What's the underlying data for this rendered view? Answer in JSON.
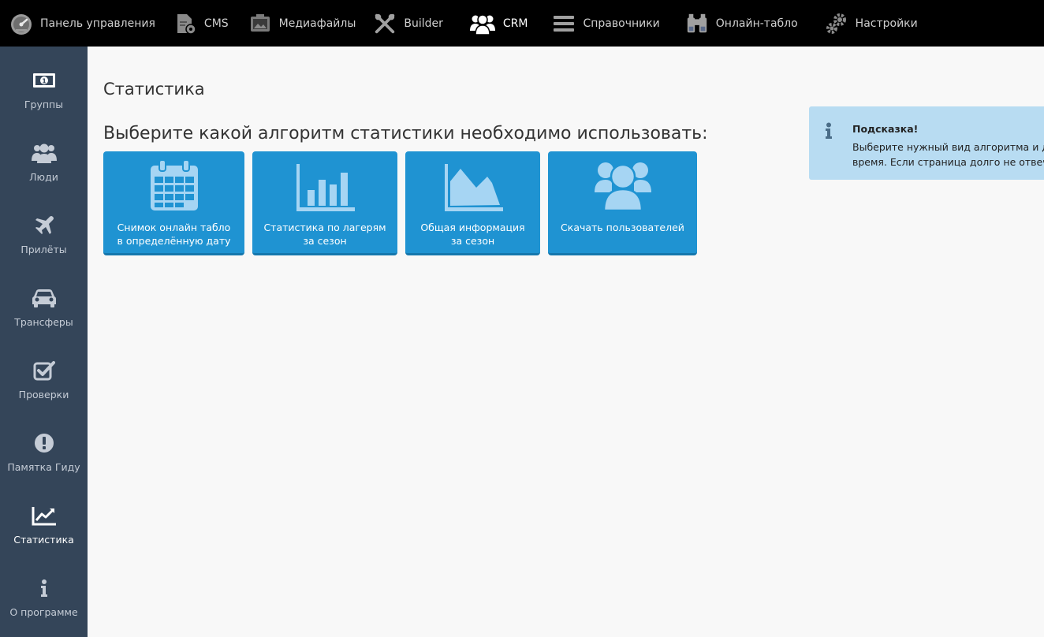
{
  "top_nav": [
    {
      "label": "Панель управления",
      "icon": "dashboard-gauge-icon"
    },
    {
      "label": "CMS",
      "icon": "cms-document-icon"
    },
    {
      "label": "Медиафайлы",
      "icon": "media-image-icon"
    },
    {
      "label": "Builder",
      "icon": "builder-tools-icon"
    },
    {
      "label": "CRM",
      "icon": "crm-users-icon",
      "active": true
    },
    {
      "label": "Справочники",
      "icon": "list-bars-icon"
    },
    {
      "label": "Онлайн-табло",
      "icon": "binoculars-icon"
    },
    {
      "label": "Настройки",
      "icon": "settings-gears-icon"
    }
  ],
  "sidebar": [
    {
      "label": "Группы",
      "icon": "money-bill-icon"
    },
    {
      "label": "Люди",
      "icon": "people-icon"
    },
    {
      "label": "Прилёты",
      "icon": "airplane-icon"
    },
    {
      "label": "Трансферы",
      "icon": "car-icon"
    },
    {
      "label": "Проверки",
      "icon": "checkbox-icon"
    },
    {
      "label": "Памятка Гиду",
      "icon": "exclamation-circle-icon"
    },
    {
      "label": "Статистика",
      "icon": "line-chart-icon",
      "active": true
    },
    {
      "label": "О программе",
      "icon": "info-icon"
    }
  ],
  "main": {
    "title": "Статистика",
    "subtitle": "Выберите какой алгоритм статистики необходимо использовать:",
    "tiles": [
      {
        "line1": "Снимок онлайн табло",
        "line2": "в определённую дату",
        "icon": "calendar-icon"
      },
      {
        "line1": "Статистика по лагерям",
        "line2": "за сезон",
        "icon": "bar-chart-icon"
      },
      {
        "line1": "Общая информация",
        "line2": "за сезон",
        "icon": "area-chart-icon"
      },
      {
        "line1": "Скачать пользователей",
        "line2": "",
        "icon": "users-group-icon"
      }
    ]
  },
  "hint": {
    "title": "Подсказка!",
    "line1": "Выберите нужный вид алгоритма и дождитесь",
    "line2": "время. Если страница долго не отвечает, обновите её",
    "icon": "info-icon"
  },
  "colors": {
    "topbar": "#000000",
    "sidebar": "#344559",
    "tile": "#1f93d2",
    "hint": "#b8dcf2"
  }
}
